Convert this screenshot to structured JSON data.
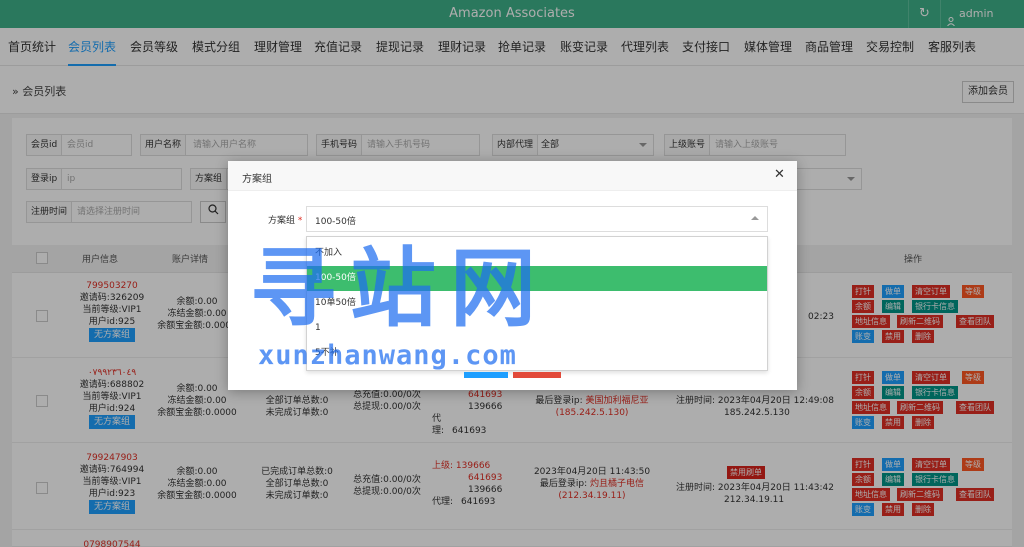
{
  "header": {
    "title": "Amazon Associates",
    "refresh_icon": "↻",
    "user_icon": "person-icon",
    "user": "admin"
  },
  "nav": [
    "首页统计",
    "会员列表",
    "会员等级",
    "模式分组",
    "理财管理",
    "充值记录",
    "提现记录",
    "理财记录",
    "抢单记录",
    "账变记录",
    "代理列表",
    "支付接口",
    "媒体管理",
    "商品管理",
    "交易控制",
    "客服列表"
  ],
  "nav_active": "会员列表",
  "breadcrumb": {
    "arrow": "»",
    "label": "会员列表",
    "add_button": "添加会员"
  },
  "filters": {
    "member_id": {
      "label": "会员id",
      "placeholder": "会员id"
    },
    "username": {
      "label": "用户名称",
      "placeholder": "请输入用户名称"
    },
    "phone": {
      "label": "手机号码",
      "placeholder": "请输入手机号码"
    },
    "internal_agent": {
      "label": "内部代理",
      "value": "全部"
    },
    "parent": {
      "label": "上级账号",
      "placeholder": "请输入上级账号"
    },
    "login_ip": {
      "label": "登录ip",
      "placeholder": "ip"
    },
    "plan_group": {
      "label": "方案组"
    },
    "reg_time": {
      "label": "注册时间",
      "placeholder": "请选择注册时间"
    }
  },
  "table": {
    "headers": {
      "user_info": "用户信息",
      "account": "账户详情",
      "ops": "操作"
    },
    "rows": [
      {
        "id": "799503270",
        "invite": "邀请码:326209",
        "level": "当前等级:VIP1",
        "uid": "用户id:925",
        "plan": "无方案组",
        "balance": "余额:0.00",
        "frozen": "冻结金额:0.00",
        "yuebao": "余额宝金额:0.0000",
        "time_tail": "02:23"
      },
      {
        "id": "٠٧٩٩٢٣٦٠٤٩",
        "invite": "邀请码:688802",
        "level": "当前等级:VIP1",
        "uid": "用户id:924",
        "plan": "无方案组",
        "balance": "余额:0.00",
        "frozen": "冻结金额:0.00",
        "yuebao": "余额宝金额:0.0000",
        "orders_all": "全部订单总数:0",
        "orders_open": "未完成订单数:0",
        "recharge": "总充值:0.00/0次",
        "withdraw": "总提现:0.00/0次",
        "sup_tail": "641693",
        "agent_label": "代理:",
        "agent_1": "139666",
        "agent_2": "641693",
        "last_ip_label": "最后登录ip:",
        "last_ip_loc": "美国加利福尼亚",
        "last_ip": "(185.242.5.130)",
        "reg_label": "注册时间:",
        "reg_date": "2023年04月20日 12:49:08",
        "reg_ip": "185.242.5.130"
      },
      {
        "id": "799247903",
        "invite": "邀请码:764994",
        "level": "当前等级:VIP1",
        "uid": "用户id:923",
        "plan": "无方案组",
        "balance": "余额:0.00",
        "frozen": "冻结金额:0.00",
        "yuebao": "余额宝金额:0.0000",
        "orders_done": "已完成订单总数:0",
        "orders_all": "全部订单总数:0",
        "orders_open": "未完成订单数:0",
        "recharge": "总充值:0.00/0次",
        "withdraw": "总提现:0.00/0次",
        "sup_label": "上级:",
        "sup_1": "139666",
        "sup_2": "641693",
        "agent_label": "代理:",
        "agent_1": "139666",
        "agent_2": "641693",
        "login_time": "2023年04月20日 11:43:50",
        "last_ip_label": "最后登录ip:",
        "last_ip_loc": "灼且橘子电信",
        "last_ip": "(212.34.19.11)",
        "ban": "禁用刷单",
        "reg_label": "注册时间:",
        "reg_date": "2023年04月20日 11:43:42",
        "reg_ip": "212.34.19.11"
      },
      {
        "id": "0798907544"
      }
    ]
  },
  "ops": {
    "print": "打针",
    "single": "做单",
    "clear": "清空订单",
    "level": "等级",
    "balance": "余额",
    "edit": "编辑",
    "bank": "银行卡信息",
    "address": "地址信息",
    "qr": "刷新二维码",
    "team": "查看团队",
    "ledger": "账变",
    "disable": "禁用",
    "delete": "删除"
  },
  "modal": {
    "title": "方案组",
    "close_icon": "✕",
    "field_label": "方案组",
    "required_mark": "*",
    "selected": "100-50倍",
    "options": [
      "不加入",
      "100-50倍",
      "10单50倍",
      "1",
      "5不补"
    ]
  },
  "watermark": {
    "line1": "寻站网",
    "line2": "xunzhanwang.com"
  },
  "colors": {
    "header": "#3fb28a",
    "accent": "#1e9fff",
    "selected_option": "#3dbd6e",
    "danger": "#e02e24"
  }
}
